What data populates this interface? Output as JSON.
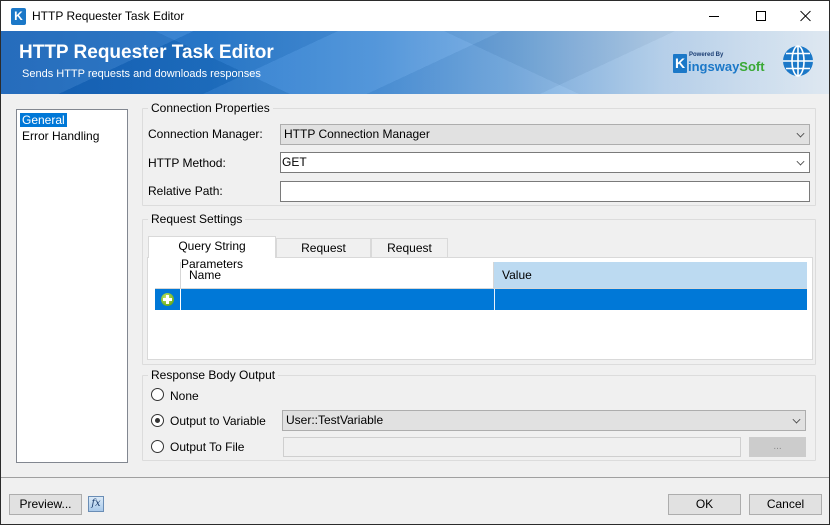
{
  "window": {
    "title": "HTTP Requester Task Editor",
    "app_icon": "K",
    "controls": {
      "minimize": "minimize-icon",
      "maximize": "maximize-icon",
      "close": "close-icon"
    }
  },
  "banner": {
    "title": "HTTP Requester Task Editor",
    "subtitle": "Sends HTTP requests and downloads responses",
    "brand": {
      "powered_by": "Powered By",
      "k": "K",
      "name_part1": "ingsway",
      "name_part2": "Soft"
    },
    "brand_colors": {
      "blue": "#1b78c8",
      "green": "#3aa935"
    }
  },
  "nav": {
    "items": [
      {
        "label": "General",
        "selected": true
      },
      {
        "label": "Error Handling",
        "selected": false
      }
    ]
  },
  "connection": {
    "group_title": "Connection Properties",
    "connection_manager_label": "Connection Manager:",
    "connection_manager_value": "HTTP Connection Manager",
    "http_method_label": "HTTP Method:",
    "http_method_value": "GET",
    "relative_path_label": "Relative Path:",
    "relative_path_value": ""
  },
  "request": {
    "group_title": "Request Settings",
    "tabs": [
      {
        "label": "Query String Parameters",
        "active": true
      },
      {
        "label": "Request Headers",
        "active": false
      },
      {
        "label": "Request Body",
        "active": false
      }
    ],
    "grid": {
      "columns": [
        "Name",
        "Value"
      ],
      "rows": [
        {
          "name": "",
          "value": "",
          "new_row": true
        }
      ]
    }
  },
  "response": {
    "group_title": "Response Body Output",
    "options": [
      {
        "label": "None",
        "checked": false
      },
      {
        "label": "Output to Variable",
        "checked": true
      },
      {
        "label": "Output To File",
        "checked": false
      }
    ],
    "variable_value": "User::TestVariable",
    "file_path_value": "",
    "browse_label": "..."
  },
  "footer": {
    "preview_label": "Preview...",
    "fx_label": "fx",
    "ok_label": "OK",
    "cancel_label": "Cancel"
  },
  "colors": {
    "selection": "#0078d7",
    "header_highlight": "#bcdaf1",
    "dialog_bg": "#f0f0f0"
  }
}
